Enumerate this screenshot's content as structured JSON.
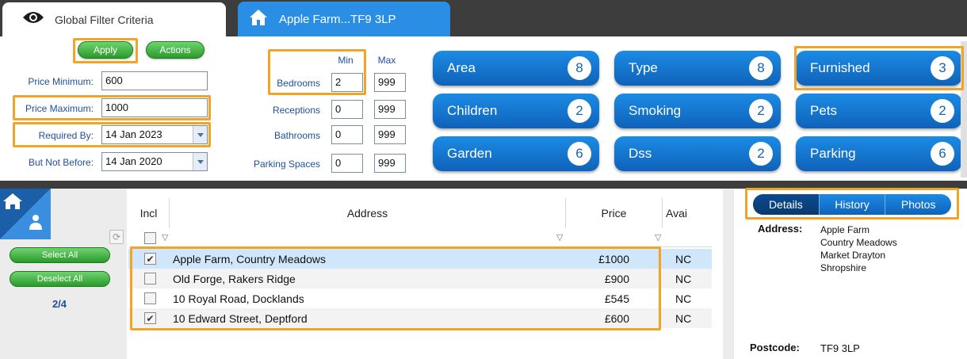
{
  "tabs": {
    "filter_label": "Global Filter Criteria",
    "property_label": "Apple Farm...TF9 3LP"
  },
  "filter": {
    "apply_label": "Apply",
    "actions_label": "Actions",
    "price_min_label": "Price Minimum:",
    "price_min_value": "600",
    "price_max_label": "Price Maximum:",
    "price_max_value": "1000",
    "required_by_label": "Required By:",
    "required_by_value": "14 Jan 2023",
    "not_before_label": "But Not Before:",
    "not_before_value": "14 Jan 2020",
    "min_header": "Min",
    "max_header": "Max",
    "rooms": [
      {
        "label": "Bedrooms",
        "min": "2",
        "max": "999"
      },
      {
        "label": "Receptions",
        "min": "0",
        "max": "999"
      },
      {
        "label": "Bathrooms",
        "min": "0",
        "max": "999"
      },
      {
        "label": "Parking Spaces",
        "min": "0",
        "max": "999"
      }
    ]
  },
  "criteria": [
    {
      "label": "Area",
      "count": "8"
    },
    {
      "label": "Type",
      "count": "8"
    },
    {
      "label": "Furnished",
      "count": "3"
    },
    {
      "label": "Children",
      "count": "2"
    },
    {
      "label": "Smoking",
      "count": "2"
    },
    {
      "label": "Pets",
      "count": "2"
    },
    {
      "label": "Garden",
      "count": "6"
    },
    {
      "label": "Dss",
      "count": "2"
    },
    {
      "label": "Parking",
      "count": "6"
    }
  ],
  "left": {
    "select_all": "Select All",
    "deselect_all": "Deselect All",
    "count": "2/4"
  },
  "grid": {
    "headers": {
      "incl": "Incl",
      "address": "Address",
      "price": "Price",
      "avail": "Avai"
    },
    "rows": [
      {
        "address": "Apple Farm, Country Meadows",
        "price": "£1000",
        "avail": "NC",
        "checked": true
      },
      {
        "address": "Old Forge, Rakers Ridge",
        "price": "£900",
        "avail": "NC",
        "checked": false
      },
      {
        "address": "10 Royal Road, Docklands",
        "price": "£545",
        "avail": "NC",
        "checked": false
      },
      {
        "address": "10 Edward Street, Deptford",
        "price": "£600",
        "avail": "NC",
        "checked": true
      }
    ]
  },
  "details": {
    "tabs": [
      "Details",
      "History",
      "Photos"
    ],
    "address_label": "Address:",
    "address_lines": [
      "Apple Farm",
      "Country Meadows",
      "Market Drayton",
      "Shropshire"
    ],
    "postcode_label": "Postcode:",
    "postcode_value": "TF9 3LP"
  },
  "colors": {
    "accent_blue": "#1c8be4",
    "highlight": "#f0a428",
    "green": "#2a9a2a",
    "selected_row": "#cfe6fb"
  }
}
